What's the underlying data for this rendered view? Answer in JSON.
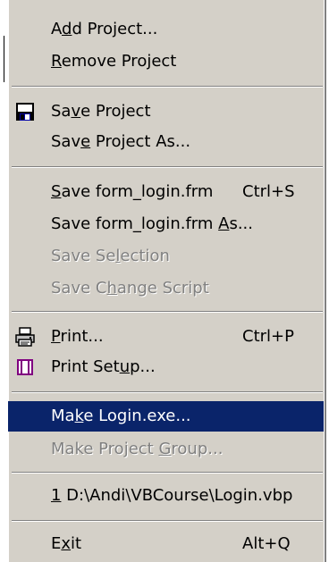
{
  "menu": {
    "items": [
      {
        "pre": "A",
        "acc": "d",
        "post": "d Project...",
        "shortcut": "",
        "disabled": false,
        "highlight": false,
        "icon": ""
      },
      {
        "pre": "",
        "acc": "R",
        "post": "emove Project",
        "shortcut": "",
        "disabled": false,
        "highlight": false,
        "icon": ""
      },
      {
        "pre": "Sa",
        "acc": "v",
        "post": "e Project",
        "shortcut": "",
        "disabled": false,
        "highlight": false,
        "icon": "floppy-disk-icon"
      },
      {
        "pre": "Sav",
        "acc": "e",
        "post": " Project As...",
        "shortcut": "",
        "disabled": false,
        "highlight": false,
        "icon": ""
      },
      {
        "pre": "",
        "acc": "S",
        "post": "ave form_login.frm",
        "shortcut": "Ctrl+S",
        "disabled": false,
        "highlight": false,
        "icon": ""
      },
      {
        "pre": "Save form_login.frm ",
        "acc": "A",
        "post": "s...",
        "shortcut": "",
        "disabled": false,
        "highlight": false,
        "icon": ""
      },
      {
        "pre": "Save Se",
        "acc": "l",
        "post": "ection",
        "shortcut": "",
        "disabled": true,
        "highlight": false,
        "icon": ""
      },
      {
        "pre": "Save C",
        "acc": "h",
        "post": "ange Script",
        "shortcut": "",
        "disabled": true,
        "highlight": false,
        "icon": ""
      },
      {
        "pre": "",
        "acc": "P",
        "post": "rint...",
        "shortcut": "Ctrl+P",
        "disabled": false,
        "highlight": false,
        "icon": "printer-icon"
      },
      {
        "pre": "Print Set",
        "acc": "u",
        "post": "p...",
        "shortcut": "",
        "disabled": false,
        "highlight": false,
        "icon": "print-setup-icon"
      },
      {
        "pre": "Ma",
        "acc": "k",
        "post": "e Login.exe...",
        "shortcut": "",
        "disabled": false,
        "highlight": true,
        "icon": ""
      },
      {
        "pre": "Make Project ",
        "acc": "G",
        "post": "roup...",
        "shortcut": "",
        "disabled": true,
        "highlight": false,
        "icon": ""
      },
      {
        "pre": "",
        "acc": "1",
        "post": " D:\\Andi\\VBCourse\\Login.vbp",
        "shortcut": "",
        "disabled": false,
        "highlight": false,
        "icon": ""
      },
      {
        "pre": "E",
        "acc": "x",
        "post": "it",
        "shortcut": "Alt+Q",
        "disabled": false,
        "highlight": false,
        "icon": ""
      }
    ]
  },
  "colors": {
    "menu_face": "#d4d0c8",
    "highlight": "#0a246a",
    "disabled_text": "#808080"
  }
}
